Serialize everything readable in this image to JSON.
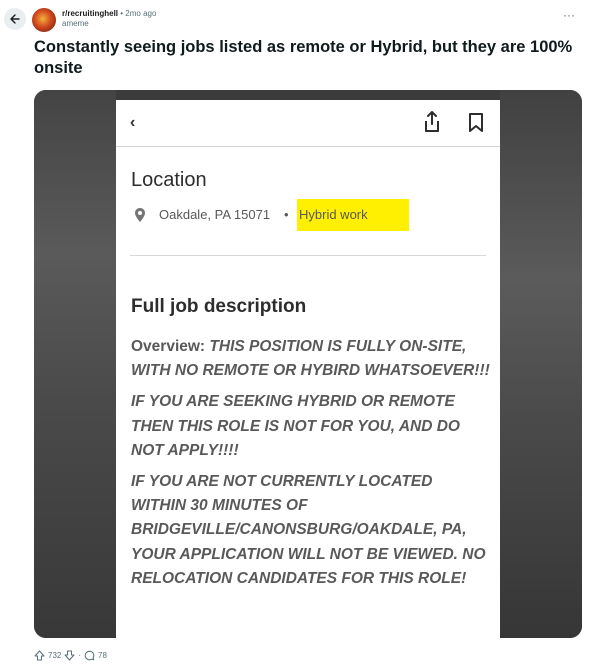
{
  "post": {
    "subreddit": "r/recruitinghell",
    "separator": "•",
    "time": "2mo ago",
    "user": "ameme",
    "more": "···",
    "title": "Constantly seeing jobs listed as remote or Hybrid, but they are 100% onsite"
  },
  "screenshot": {
    "back": "‹",
    "location_heading": "Location",
    "location_text": "Oakdale, PA 15071",
    "location_dot": "•",
    "work_type": "Hybrid work",
    "description_heading": "Full job description",
    "overview_label": "Overview:",
    "paragraph1": "THIS POSITION IS FULLY ON-SITE, WITH NO REMOTE OR HYBIRD WHATSOEVER!!!",
    "paragraph2": "IF YOU ARE SEEKING HYBRID OR REMOTE THEN THIS ROLE IS NOT FOR YOU, AND DO NOT APPLY!!!!",
    "paragraph3": "IF YOU ARE NOT CURRENTLY LOCATED WITHIN 30 MINUTES OF BRIDGEVILLE/CANONSBURG/OAKDALE, PA, YOUR APPLICATION WILL NOT BE VIEWED. NO RELOCATION CANDIDATES FOR THIS ROLE!"
  },
  "actions": {
    "upvotes": "732",
    "dot": "·",
    "comments": "78"
  },
  "colors": {
    "highlight": "#ffef00",
    "text": "#1a1a1b",
    "muted": "#576f76"
  }
}
